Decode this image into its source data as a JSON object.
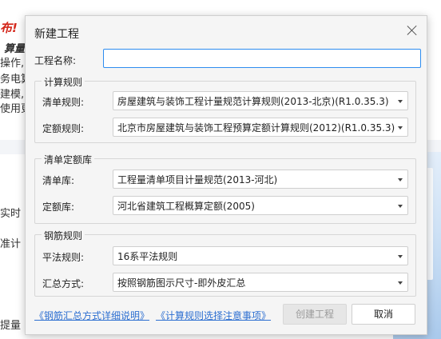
{
  "background": {
    "line1": "布!",
    "line2": "算量",
    "line3": "操作,",
    "line4": "务电算",
    "line5": "建模,",
    "line6": "使用更",
    "line7": "实时",
    "line8": "准计",
    "line9": "提量"
  },
  "dialog": {
    "title": "新建工程",
    "project_name_label": "工程名称:",
    "project_name_value": "",
    "calc_rules": {
      "legend": "计算规则",
      "list_rule_label": "清单规则:",
      "list_rule_value": "房屋建筑与装饰工程计量规范计算规则(2013-北京)(R1.0.35.3)",
      "quota_rule_label": "定额规则:",
      "quota_rule_value": "北京市房屋建筑与装饰工程预算定额计算规则(2012)(R1.0.35.3)"
    },
    "list_quota_lib": {
      "legend": "清单定额库",
      "list_lib_label": "清单库:",
      "list_lib_value": "工程量清单项目计量规范(2013-河北)",
      "quota_lib_label": "定额库:",
      "quota_lib_value": "河北省建筑工程概算定额(2005)"
    },
    "rebar_rules": {
      "legend": "钢筋规则",
      "flat_rule_label": "平法规则:",
      "flat_rule_value": "16系平法规则",
      "summary_label": "汇总方式:",
      "summary_value": "按照钢筋图示尺寸-即外皮汇总"
    },
    "link_summary": "《钢筋汇总方式详细说明》",
    "link_rules": "《计算规则选择注意事项》",
    "create_button": "创建工程",
    "cancel_button": "取消"
  }
}
